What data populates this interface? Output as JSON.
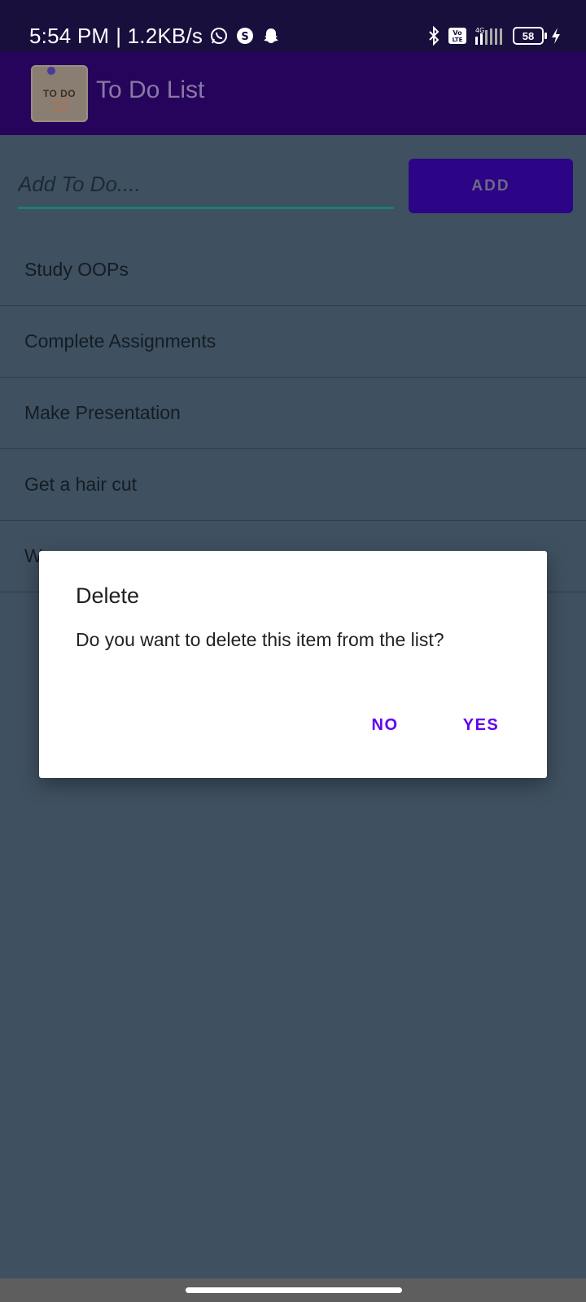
{
  "status_bar": {
    "time": "5:54 PM",
    "network_speed": "| 1.2KB/s",
    "battery_level": "58",
    "icons": [
      "whatsapp-icon",
      "skype-icon",
      "snapchat-icon",
      "bluetooth-icon",
      "volte-icon",
      "signal-icon",
      "battery-icon",
      "charging-icon"
    ]
  },
  "app_bar": {
    "logo_text": "TO DO",
    "title": "To Do List"
  },
  "input": {
    "placeholder": "Add To Do....",
    "value": "",
    "add_label": "ADD"
  },
  "todo_items": [
    "Study OOPs",
    "Complete Assignments",
    "Make Presentation",
    "Get a hair cut",
    "W"
  ],
  "dialog": {
    "title": "Delete",
    "message": "Do you want to delete this item from the list?",
    "no_label": "NO",
    "yes_label": "YES"
  },
  "colors": {
    "status_bar": "#180f3d",
    "app_bar": "#26045c",
    "background_dimmed": "#3f5060",
    "accent": "#6200ee",
    "input_underline": "#188078"
  }
}
